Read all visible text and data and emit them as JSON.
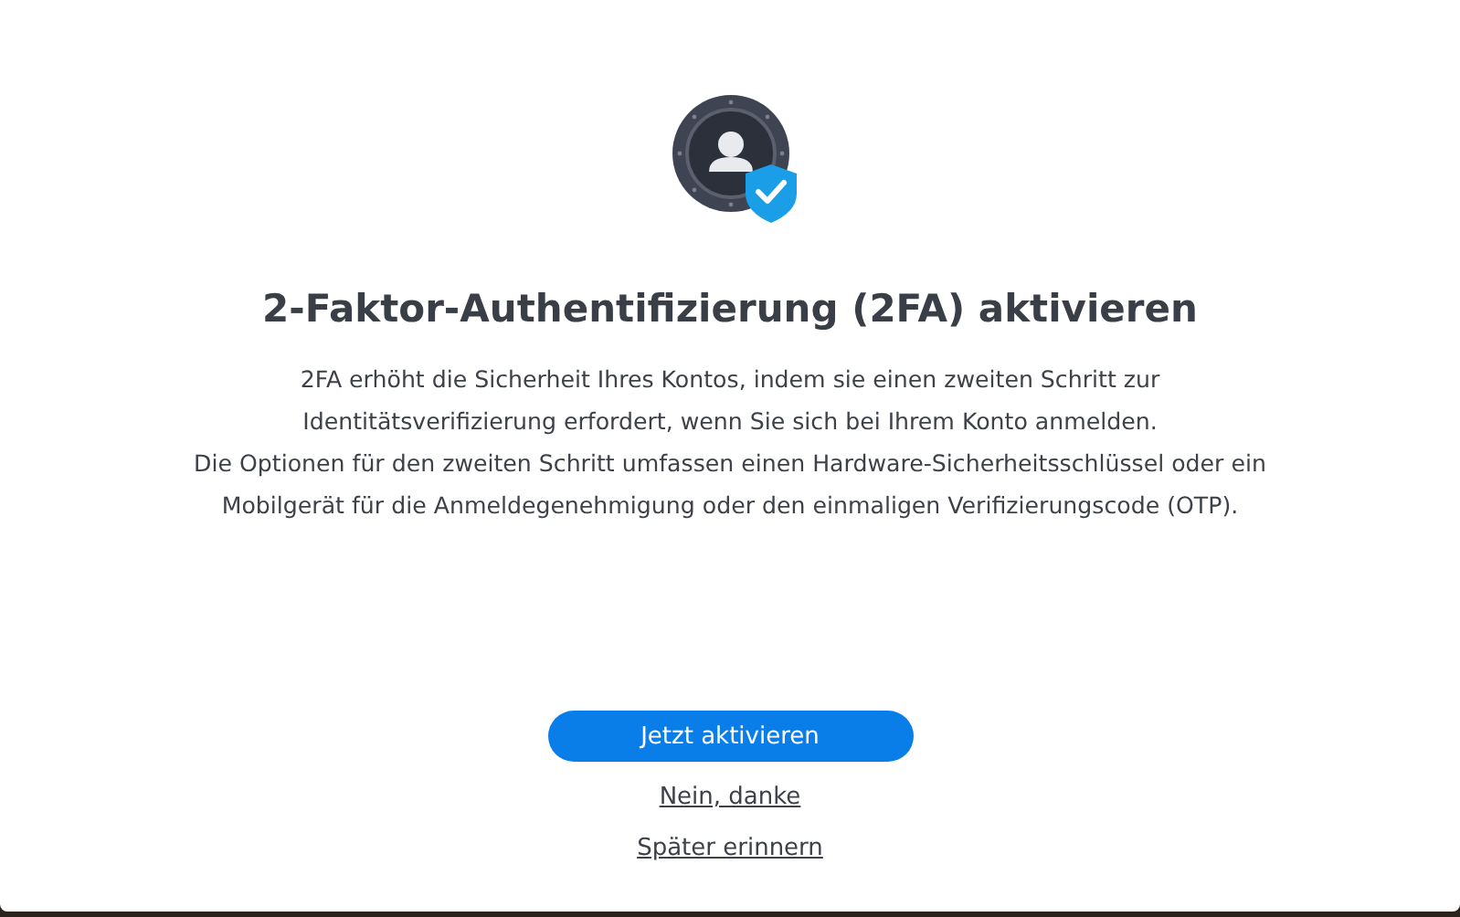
{
  "dialog": {
    "title": "2-Faktor-Authentifizierung (2FA) aktivieren",
    "paragraphs": [
      "2FA erhöht die Sicherheit Ihres Kontos, indem sie einen zweiten Schritt zur Identitätsverifizierung erfordert, wenn Sie sich bei Ihrem Konto anmelden.",
      "Die Optionen für den zweiten Schritt umfassen einen Hardware-Sicherheitsschlüssel oder ein Mobilgerät für die Anmeldegenehmigung oder den einmaligen Verifizierungscode (OTP)."
    ],
    "actions": [
      {
        "kind": "button",
        "label": "Jetzt aktivieren"
      },
      {
        "kind": "link",
        "label": "Nein, danke"
      },
      {
        "kind": "link",
        "label": "Später erinnern"
      }
    ]
  }
}
